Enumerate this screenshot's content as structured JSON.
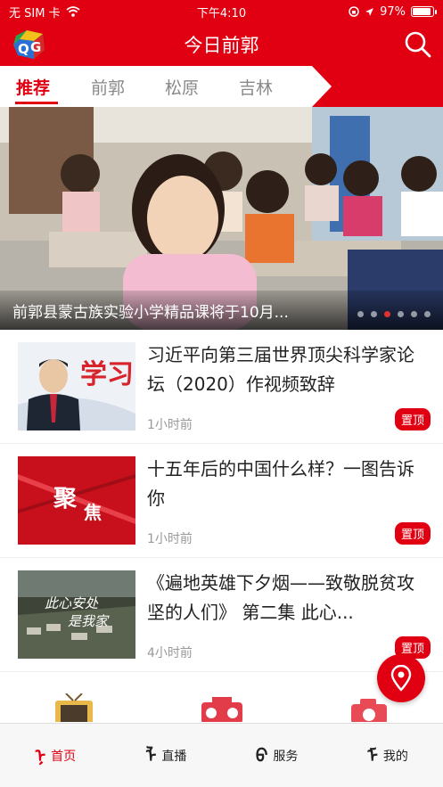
{
  "status_bar": {
    "carrier": "无 SIM 卡",
    "time": "下午4:10",
    "battery": "97%"
  },
  "header": {
    "title": "今日前郭"
  },
  "tabs": [
    {
      "label": "推荐"
    },
    {
      "label": "前郭"
    },
    {
      "label": "松原"
    },
    {
      "label": "吉林"
    }
  ],
  "banner": {
    "title": "前郭县蒙古族实验小学精品课将于10月...",
    "slide_count": 6,
    "active_slide": 3
  },
  "news": [
    {
      "title": "习近平向第三届世界顶尖科学家论坛（2020）作视频致辞",
      "time": "1小时前",
      "badge": "置顶",
      "thumb_text": "学习"
    },
    {
      "title": "十五年后的中国什么样？一图告诉你",
      "time": "1小时前",
      "badge": "置顶",
      "thumb_text_1": "聚",
      "thumb_text_2": "焦"
    },
    {
      "title": "《遍地英雄下夕烟——致敬脱贫攻坚的人们》 第二集 此心...",
      "time": "4小时前",
      "badge": "置顶",
      "thumb_text_1": "此心安处",
      "thumb_text_2": "是我家"
    }
  ],
  "bottom_tabs": [
    {
      "glyph": "ᠨ",
      "label": "首页"
    },
    {
      "glyph": "ᠯ",
      "label": "直播"
    },
    {
      "glyph": "ᠪ",
      "label": "服务"
    },
    {
      "glyph": "ᠮ",
      "label": "我的"
    }
  ],
  "icons": {
    "search": "search-icon",
    "location": "location-pin-icon",
    "logo": "app-logo-icon"
  },
  "colors": {
    "brand": "#e00012",
    "inactive": "#888888"
  }
}
